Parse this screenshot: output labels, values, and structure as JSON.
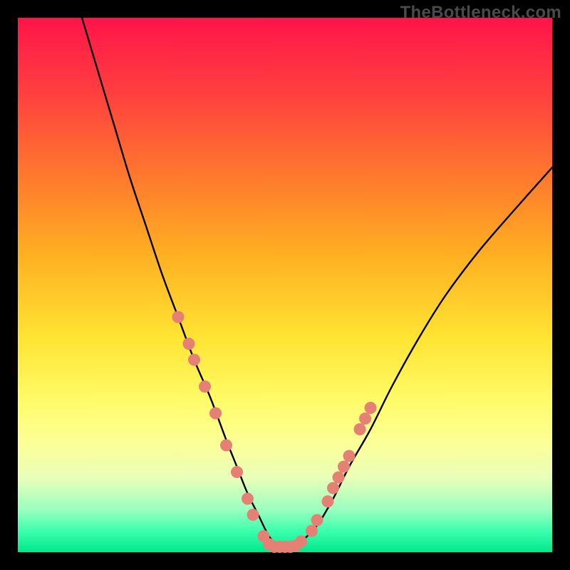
{
  "watermark": "TheBottleneck.com",
  "chart_data": {
    "type": "line",
    "title": "",
    "xlabel": "",
    "ylabel": "",
    "xlim": [
      0,
      100
    ],
    "ylim": [
      0,
      100
    ],
    "series": [
      {
        "name": "bottleneck-curve",
        "x": [
          12,
          15,
          18,
          21,
          24,
          27,
          30,
          33,
          36,
          39,
          41,
          43,
          45,
          47,
          49,
          51,
          53,
          56,
          59,
          62,
          66,
          70,
          75,
          80,
          86,
          92,
          100
        ],
        "y": [
          100,
          90,
          80,
          70,
          61,
          52,
          44,
          36,
          29,
          21,
          16,
          11,
          7,
          3,
          1,
          1,
          2,
          5,
          10,
          16,
          23,
          31,
          40,
          48,
          56,
          63,
          72
        ]
      }
    ],
    "markers": {
      "name": "highlight-dots",
      "color": "#e58074",
      "points": [
        {
          "x": 30,
          "y": 44
        },
        {
          "x": 32,
          "y": 39
        },
        {
          "x": 33,
          "y": 36
        },
        {
          "x": 35,
          "y": 31
        },
        {
          "x": 37,
          "y": 26
        },
        {
          "x": 39,
          "y": 20
        },
        {
          "x": 41,
          "y": 15
        },
        {
          "x": 43,
          "y": 10
        },
        {
          "x": 44,
          "y": 7
        },
        {
          "x": 46,
          "y": 3
        },
        {
          "x": 47,
          "y": 1.5
        },
        {
          "x": 48,
          "y": 1
        },
        {
          "x": 49,
          "y": 1
        },
        {
          "x": 50,
          "y": 1
        },
        {
          "x": 51,
          "y": 1
        },
        {
          "x": 52,
          "y": 1.2
        },
        {
          "x": 53,
          "y": 2
        },
        {
          "x": 55,
          "y": 4
        },
        {
          "x": 56,
          "y": 6
        },
        {
          "x": 58,
          "y": 9.5
        },
        {
          "x": 59,
          "y": 12
        },
        {
          "x": 60,
          "y": 14
        },
        {
          "x": 61,
          "y": 16
        },
        {
          "x": 62,
          "y": 18
        },
        {
          "x": 64,
          "y": 23
        },
        {
          "x": 65,
          "y": 25
        },
        {
          "x": 66,
          "y": 27
        }
      ]
    }
  }
}
